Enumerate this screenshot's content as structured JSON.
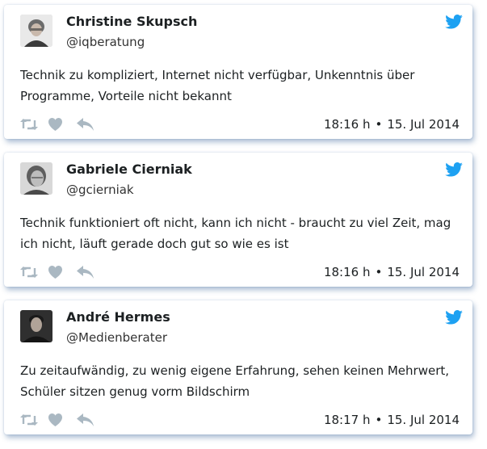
{
  "tweets": [
    {
      "name": "Christine Skupsch",
      "handle": "@iqberatung",
      "text": "Technik zu kompliziert, Internet nicht verfügbar, Unkenntnis über Programme, Vorteile nicht bekannt",
      "time": "18:16 h",
      "date": "15. Jul 2014"
    },
    {
      "name": "Gabriele Cierniak",
      "handle": "@gcierniak",
      "text": "Technik funktioniert oft nicht, kann ich nicht - braucht zu viel Zeit, mag ich nicht, läuft gerade doch gut so wie es ist",
      "time": "18:16 h",
      "date": "15. Jul 2014"
    },
    {
      "name": "André Hermes",
      "handle": "@Medienberater",
      "text": "Zu zeitaufwändig, zu wenig eigene Erfahrung, sehen keinen Mehrwert, Schüler sitzen genug vorm Bildschirm",
      "time": "18:17 h",
      "date": "15. Jul 2014"
    }
  ],
  "separator": "•",
  "icons": {
    "brand": "twitter-bird-icon",
    "retweet": "retweet-icon",
    "like": "heart-icon",
    "reply": "reply-icon"
  },
  "colors": {
    "brand": "#1da1f2",
    "action_icons": "#aab8c2",
    "text": "#1c2022",
    "card_shadow": "#466ea0"
  }
}
